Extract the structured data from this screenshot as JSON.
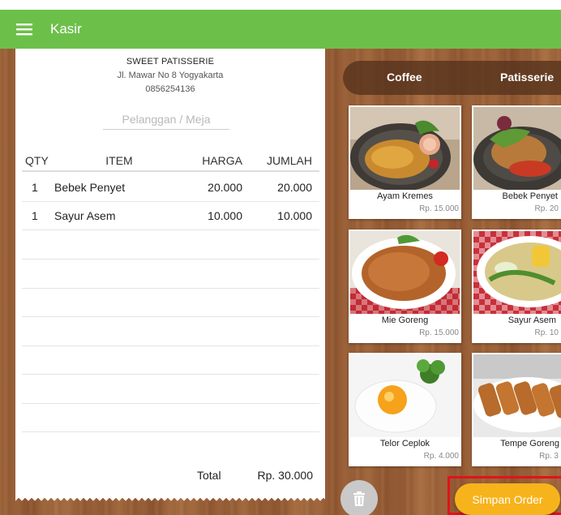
{
  "app": {
    "title": "Kasir",
    "accent": "#6cc04a"
  },
  "receipt": {
    "shop_name": "SWEET PATISSERIE",
    "address": "Jl. Mawar No 8 Yogyakarta",
    "phone": "0856254136",
    "customer_placeholder": "Pelanggan / Meja",
    "customer_value": "",
    "headers": {
      "qty": "QTY",
      "item": "ITEM",
      "harga": "HARGA",
      "jumlah": "JUMLAH"
    },
    "rows": [
      {
        "qty": "1",
        "item": "Bebek Penyet",
        "harga": "20.000",
        "jumlah": "20.000"
      },
      {
        "qty": "1",
        "item": "Sayur Asem",
        "harga": "10.000",
        "jumlah": "10.000"
      }
    ],
    "total_label": "Total",
    "total_value": "Rp. 30.000"
  },
  "categories": {
    "tabs": [
      {
        "label": "Coffee"
      },
      {
        "label": "Patisserie"
      }
    ]
  },
  "menu": {
    "items": [
      {
        "name": "Ayam Kremes",
        "price": "Rp. 15.000"
      },
      {
        "name": "Bebek Penyet",
        "price": "Rp. 20"
      },
      {
        "name": "Mie Goreng",
        "price": "Rp. 15.000"
      },
      {
        "name": "Sayur Asem",
        "price": "Rp. 10"
      },
      {
        "name": "Telor Ceplok",
        "price": "Rp. 4.000"
      },
      {
        "name": "Tempe Goreng",
        "price": "Rp. 3"
      }
    ]
  },
  "actions": {
    "save_label": "Simpan Order",
    "save_color": "#f7b31b",
    "delete_icon": "trash-icon",
    "menu_icon": "hamburger-menu-icon"
  }
}
